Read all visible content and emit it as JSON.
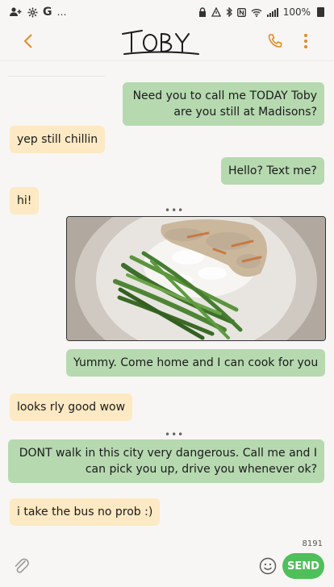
{
  "status_bar": {
    "carrier_glyph": "G",
    "more": "…",
    "battery": "100%"
  },
  "header": {
    "contact_name": "Toby"
  },
  "messages": [
    {
      "direction": "sent",
      "text": "Need you to call me TODAY Toby are you still at Madisons?"
    },
    {
      "direction": "received",
      "text": "yep still chillin"
    },
    {
      "direction": "sent",
      "text": "Hello? Text me?"
    },
    {
      "direction": "received",
      "text": "hi!"
    },
    {
      "direction": "sent",
      "type": "image",
      "image_name": "photo-of-plate-with-green-beans-rice-and-chicken"
    },
    {
      "direction": "sent",
      "text": "Yummy. Come home and I can cook for you"
    },
    {
      "direction": "received",
      "text": "looks rly good wow"
    },
    {
      "direction": "sent",
      "text": "DONT walk in this city very dangerous. Call me and I can pick you up, drive you whenever ok?"
    },
    {
      "direction": "received",
      "text": "i take the bus no prob :)"
    }
  ],
  "typing_indicator": "•••",
  "composer": {
    "char_counter": "8191",
    "send_label": "SEND"
  },
  "colors": {
    "accent": "#e48a24",
    "sent_bubble": "#b6d9b0",
    "received_bubble": "#fde9c3",
    "send_button": "#4fbf5a"
  },
  "icons": [
    "add-contact-icon",
    "settings-icon",
    "back-arrow-icon",
    "phone-icon",
    "more-vert-icon",
    "attach-icon",
    "emoji-icon"
  ]
}
